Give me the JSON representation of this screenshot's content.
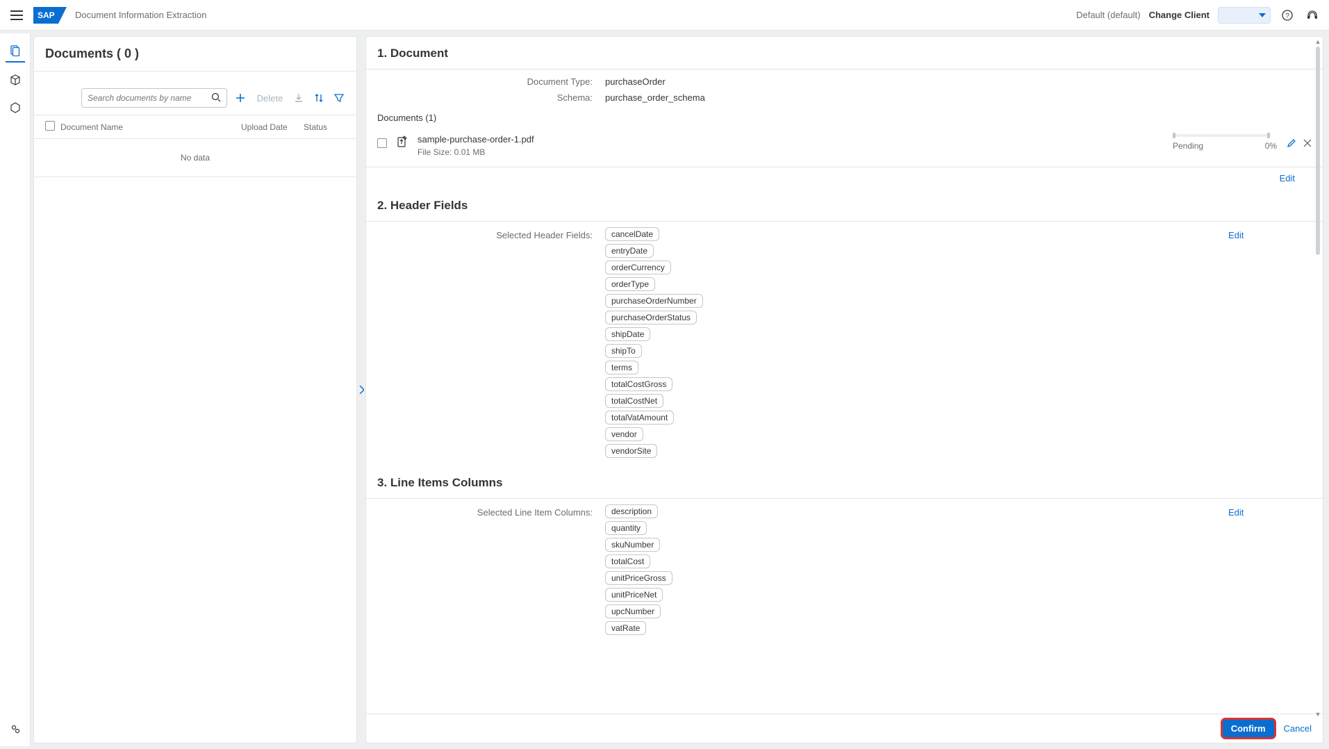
{
  "header": {
    "app_title": "Document Information Extraction",
    "default_client": "Default (default)",
    "change_client": "Change Client"
  },
  "left": {
    "title": "Documents ( 0 )",
    "search_placeholder": "Search documents by name",
    "delete_label": "Delete",
    "columns": {
      "name": "Document Name",
      "upload": "Upload Date",
      "status": "Status"
    },
    "nodata": "No data"
  },
  "right": {
    "s1": {
      "title": "1. Document",
      "doctype_label": "Document Type:",
      "doctype_value": "purchaseOrder",
      "schema_label": "Schema:",
      "schema_value": "purchase_order_schema",
      "docs_header": "Documents (1)",
      "file_name": "sample-purchase-order-1.pdf",
      "file_size": "File Size: 0.01 MB",
      "status": "Pending",
      "progress": "0%",
      "edit": "Edit"
    },
    "s2": {
      "title": "2. Header Fields",
      "selected_label": "Selected Header Fields:",
      "edit": "Edit",
      "tokens": [
        "cancelDate",
        "entryDate",
        "orderCurrency",
        "orderType",
        "purchaseOrderNumber",
        "purchaseOrderStatus",
        "shipDate",
        "shipTo",
        "terms",
        "totalCostGross",
        "totalCostNet",
        "totalVatAmount",
        "vendor",
        "vendorSite"
      ]
    },
    "s3": {
      "title": "3. Line Items Columns",
      "selected_label": "Selected Line Item Columns:",
      "edit": "Edit",
      "tokens": [
        "description",
        "quantity",
        "skuNumber",
        "totalCost",
        "unitPriceGross",
        "unitPriceNet",
        "upcNumber",
        "vatRate"
      ]
    },
    "footer": {
      "confirm": "Confirm",
      "cancel": "Cancel"
    }
  }
}
